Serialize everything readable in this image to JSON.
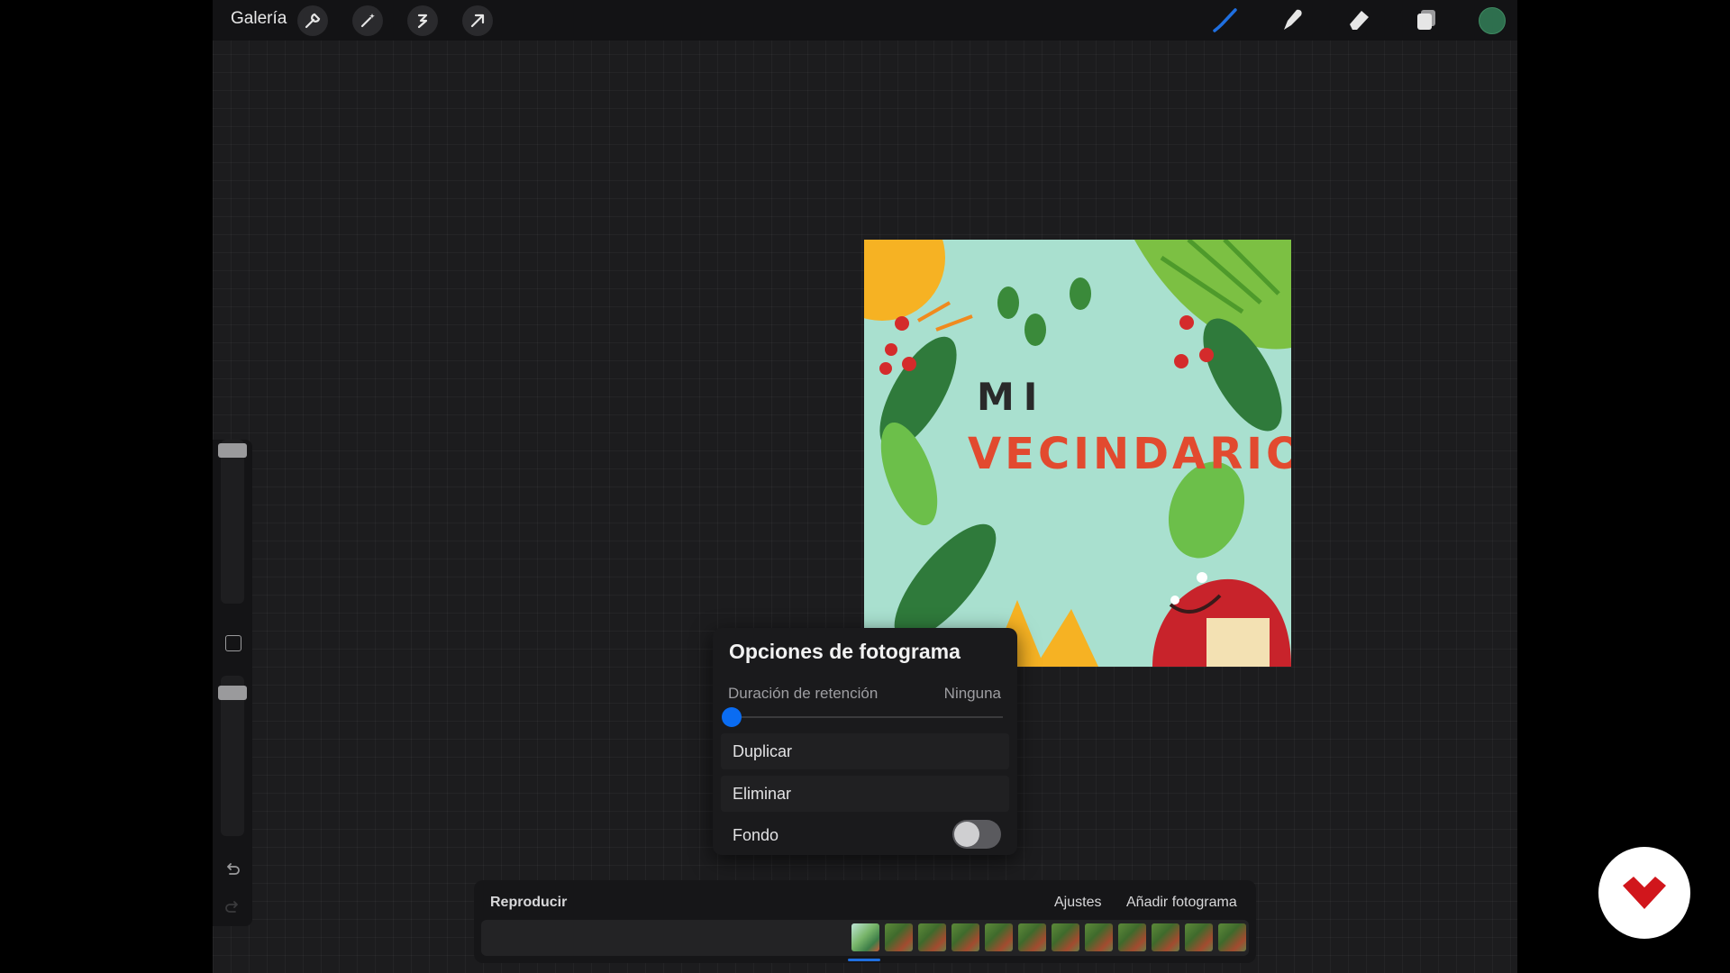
{
  "topbar": {
    "gallery_label": "Galería",
    "left_tools": [
      "wrench-icon",
      "magic-wand-icon",
      "selection-icon",
      "transform-arrow-icon"
    ],
    "right_tools": [
      "brush-icon",
      "smudge-icon",
      "eraser-icon",
      "layers-icon"
    ],
    "active_tool": "brush-icon",
    "accent_color": "#1f6fe0",
    "current_color": "#2e6f4e"
  },
  "artwork": {
    "title_line1": "MI",
    "title_line2": "VECINDARIO"
  },
  "frame_options": {
    "title": "Opciones de fotograma",
    "hold_label": "Duración de retención",
    "hold_value": "Ninguna",
    "hold_slider_value": 0,
    "duplicate_label": "Duplicar",
    "delete_label": "Eliminar",
    "background_label": "Fondo",
    "background_enabled": false
  },
  "timeline": {
    "play_label": "Reproducir",
    "settings_label": "Ajustes",
    "add_frame_label": "Añadir fotograma",
    "frame_count": 12,
    "selected_frame_index": 0
  }
}
